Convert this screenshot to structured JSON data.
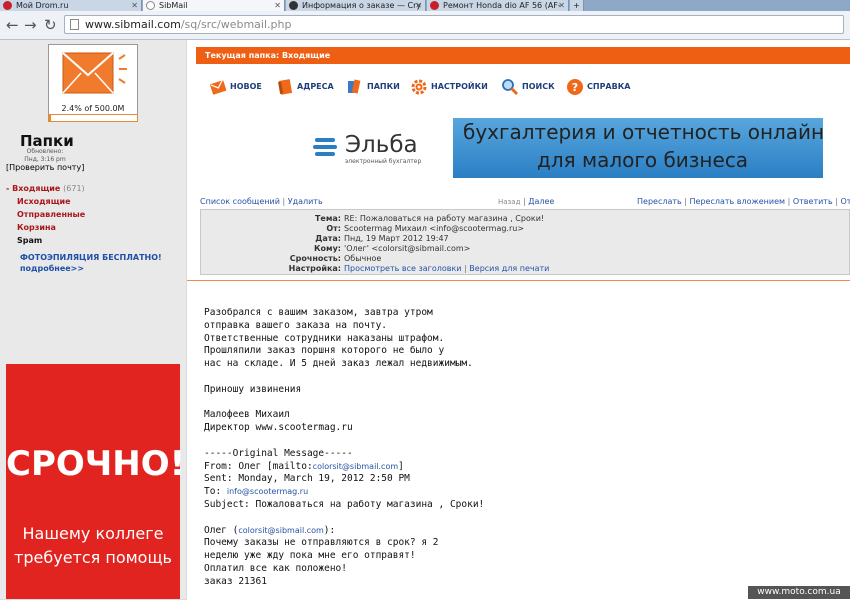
{
  "browser": {
    "tabs": [
      {
        "title": "Мой Drom.ru",
        "icon_color": "#c8202a"
      },
      {
        "title": "SibMail",
        "icon_color": "#888888"
      },
      {
        "title": "Информация о заказе — Cry",
        "icon_color": "#333333"
      },
      {
        "title": "Ремонт Honda dio AF 56 (AF-",
        "icon_color": "#c8202a"
      }
    ],
    "url_host": "www.sibmail.com",
    "url_path": "/sq/src/webmail.php"
  },
  "sidebar": {
    "quota_text": "2.4% of 500.0M",
    "quota_percent": 2.4,
    "folders_title": "Папки",
    "updated_label": "Обновлено:",
    "updated_time": "Пнд, 3:16 pm",
    "check_mail": "[Проверить почту]",
    "inbox_label": "Входящие",
    "inbox_count": "(671)",
    "subfolders": [
      "Исходящие",
      "Отправленные",
      "Корзина"
    ],
    "spam_label": "Spam",
    "promo_line1": "ФОТОЭПИЛЯЦИЯ БЕСПЛАТНО!",
    "promo_line2": "подробнее>>",
    "ad_big": "СРОЧНО!",
    "ad_line1": "Нашему коллеге",
    "ad_line2": "требуется помощь"
  },
  "main": {
    "current_folder": "Текущая папка: Входящие",
    "menu": [
      "НОВОЕ",
      "АДРЕСА",
      "ПАПКИ",
      "НАСТРОЙКИ",
      "ПОИСК",
      "СПРАВКА"
    ],
    "banner": {
      "brand": "Эльба",
      "brand_sub": "электронный бухгалтер",
      "line1": "бухгалтерия и отчетность онлайн",
      "line2": "для малого бизнеса"
    },
    "nav": {
      "message_list": "Список сообщений",
      "delete": "Удалить",
      "back": "Назад",
      "next": "Далее",
      "forward": "Переслать",
      "forward_attach": "Переслать вложением",
      "reply": "Ответить",
      "reply_all": "Отв"
    },
    "headers": {
      "subject_label": "Тема:",
      "subject": "RE: Пожаловаться на работу магазина , Сроки!",
      "from_label": "От:",
      "from": "Scootermag Михаил <info@scootermag.ru>",
      "date_label": "Дата:",
      "date": "Пнд, 19 Март 2012 19:47",
      "to_label": "Кому:",
      "to": "'Олег' <colorsit@sibmail.com>",
      "priority_label": "Срочность:",
      "priority": "Обычное",
      "options_label": "Настройка:",
      "view_headers": "Просмотреть все заголовки",
      "print_version": "Версия для печати"
    },
    "body": {
      "p1": "Разобрался с вашим заказом, завтра утром\nотправка вашего заказа на почту.\nОтветственные сотрудники наказаны штрафом.\nПрошляпили заказ поршня которого не было у\nнас на складе. И 5 дней заказ лежал недвижимым.",
      "p2": "Приношу извинения",
      "p3": "Малофеев Михаил\nДиректор www.scootermag.ru",
      "orig_header": "-----Original Message-----",
      "from_prefix": "From: Олег [mailto:",
      "from_link": "colorsit@sibmail.com",
      "from_suffix": "]",
      "sent": "Sent: Monday, March 19, 2012 2:50 PM",
      "to_prefix": "To: ",
      "to_link": "info@scootermag.ru",
      "subject": "Subject: Пожаловаться на работу магазина , Сроки!",
      "quote_prefix": "Олег (",
      "quote_link": "colorsit@sibmail.com",
      "quote_suffix": "):",
      "p4": "Почему заказы не отправляются в срок? я 2\nнеделю уже жду пока мне его отправят!\nОплатил все как положено!\nзаказ 21361"
    }
  },
  "watermark": "www.moto.com.ua"
}
